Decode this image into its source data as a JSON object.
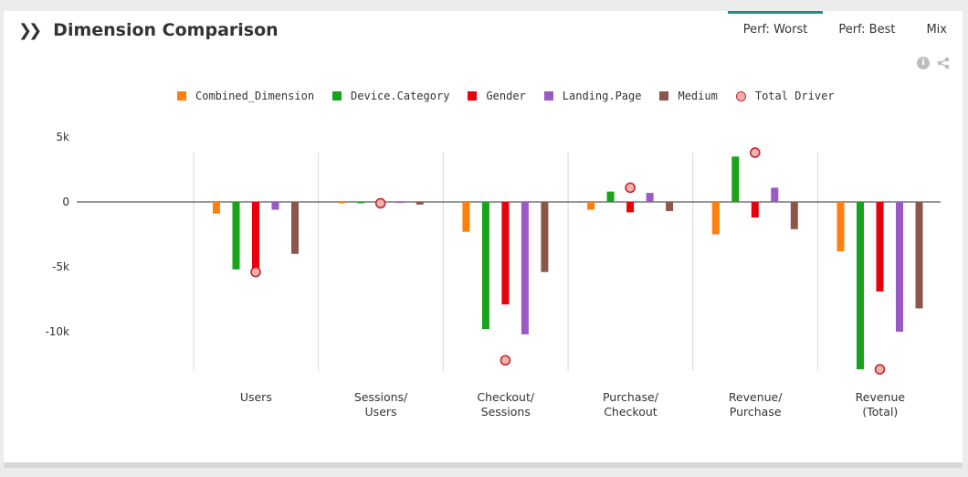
{
  "header": {
    "title": "Dimension Comparison",
    "chevron_icon": "double-chevron-right-icon"
  },
  "tabs": [
    {
      "label": "Perf: Worst",
      "active": true
    },
    {
      "label": "Perf: Best",
      "active": false
    },
    {
      "label": "Mix",
      "active": false
    }
  ],
  "tools": {
    "info_icon": "info-icon",
    "share_icon": "share-icon",
    "info_glyph": "i",
    "share_glyph": "<"
  },
  "legend": [
    {
      "label": "Combined_Dimension",
      "color": "#ff7f0e",
      "shape": "square"
    },
    {
      "label": "Device.Category",
      "color": "#1aa31a",
      "shape": "square"
    },
    {
      "label": "Gender",
      "color": "#e8000b",
      "shape": "square"
    },
    {
      "label": "Landing.Page",
      "color": "#9b59c6",
      "shape": "square"
    },
    {
      "label": "Medium",
      "color": "#8c564b",
      "shape": "square"
    },
    {
      "label": "Total Driver",
      "color": "#c0262b",
      "shape": "circle"
    }
  ],
  "chart_data": {
    "type": "bar",
    "categories": [
      [
        "Users"
      ],
      [
        "Sessions/",
        "Users"
      ],
      [
        "Checkout/",
        "Sessions"
      ],
      [
        "Purchase/",
        "Checkout"
      ],
      [
        "Revenue/",
        "Purchase"
      ],
      [
        "Revenue",
        "(Total)"
      ]
    ],
    "series": [
      {
        "name": "Combined_Dimension",
        "color": "#ff7f0e",
        "values": [
          -900,
          -100,
          -2300,
          -600,
          -2500,
          -3800
        ]
      },
      {
        "name": "Device.Category",
        "color": "#1aa31a",
        "values": [
          -5200,
          -100,
          -9800,
          800,
          3500,
          -12900
        ]
      },
      {
        "name": "Gender",
        "color": "#e8000b",
        "values": [
          -5400,
          -100,
          -7900,
          -800,
          -1200,
          -6900
        ]
      },
      {
        "name": "Landing.Page",
        "color": "#9b59c6",
        "values": [
          -600,
          -80,
          -10200,
          700,
          1100,
          -10000
        ]
      },
      {
        "name": "Medium",
        "color": "#8c564b",
        "values": [
          -4000,
          -200,
          -5400,
          -700,
          -2100,
          -8200
        ]
      }
    ],
    "total_driver": {
      "name": "Total Driver",
      "values": [
        -5400,
        -100,
        -12200,
        1100,
        3800,
        -12900
      ]
    },
    "yticks": [
      {
        "value": 5000,
        "label": "5k"
      },
      {
        "value": 0,
        "label": "0"
      },
      {
        "value": -5000,
        "label": "-5k"
      },
      {
        "value": -10000,
        "label": "-10k"
      }
    ],
    "ylim": [
      -13200,
      5000
    ]
  }
}
